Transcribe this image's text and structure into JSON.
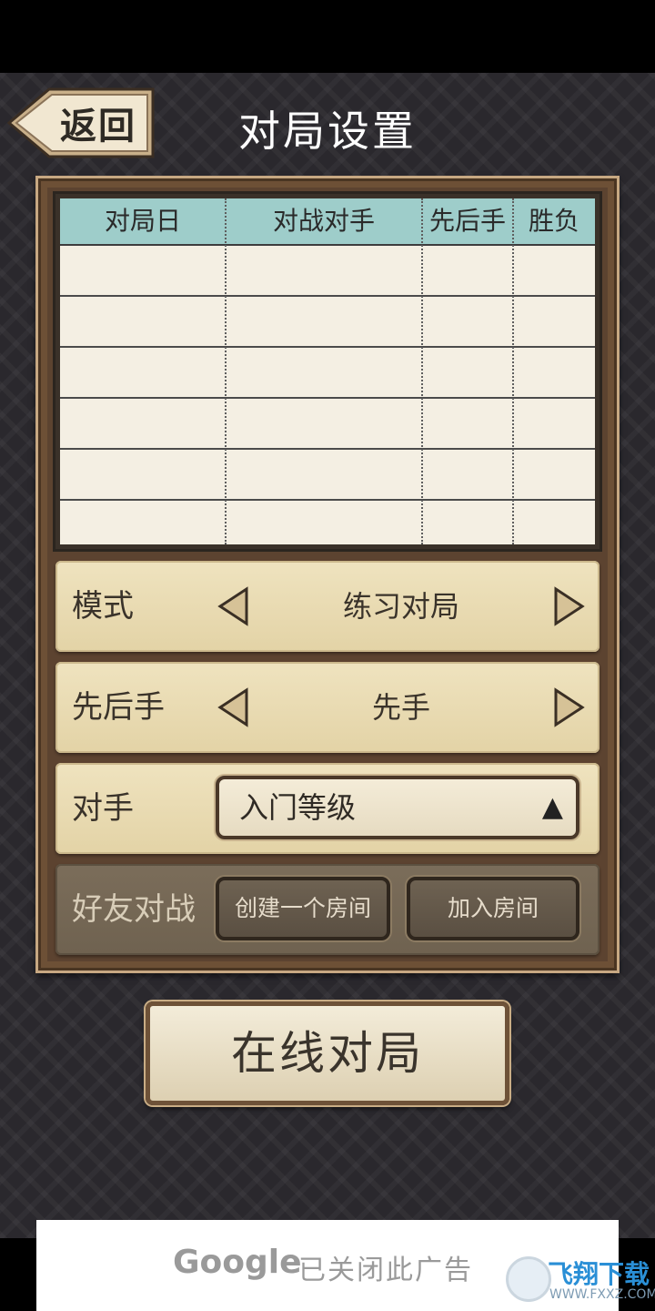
{
  "header": {
    "back_label": "返回",
    "title": "对局设置"
  },
  "history_table": {
    "columns": [
      "对局日",
      "对战对手",
      "先后手",
      "胜负"
    ],
    "rows": [
      [
        "",
        "",
        "",
        ""
      ],
      [
        "",
        "",
        "",
        ""
      ],
      [
        "",
        "",
        "",
        ""
      ],
      [
        "",
        "",
        "",
        ""
      ],
      [
        "",
        "",
        "",
        ""
      ],
      [
        "",
        "",
        "",
        ""
      ]
    ]
  },
  "settings": {
    "mode": {
      "label": "模式",
      "value": "练习对局"
    },
    "turn_order": {
      "label": "先后手",
      "value": "先手"
    },
    "opponent": {
      "label": "对手",
      "value": "入门等级",
      "caret": "▲"
    },
    "friend_match": {
      "label": "好友对战",
      "create_room": "创建一个房间",
      "join_room": "加入房间"
    }
  },
  "online_button_label": "在线对局",
  "ad": {
    "brand": "Google",
    "message": "已关闭此广告"
  },
  "watermark": {
    "name": "飞翔下载",
    "url": "WWW.FXXZ.COM"
  },
  "colors": {
    "table_header": "#9ecdca",
    "panel_wood": "#6d5036",
    "setting_bg": "#e9dcb5",
    "background": "#2a282d"
  }
}
